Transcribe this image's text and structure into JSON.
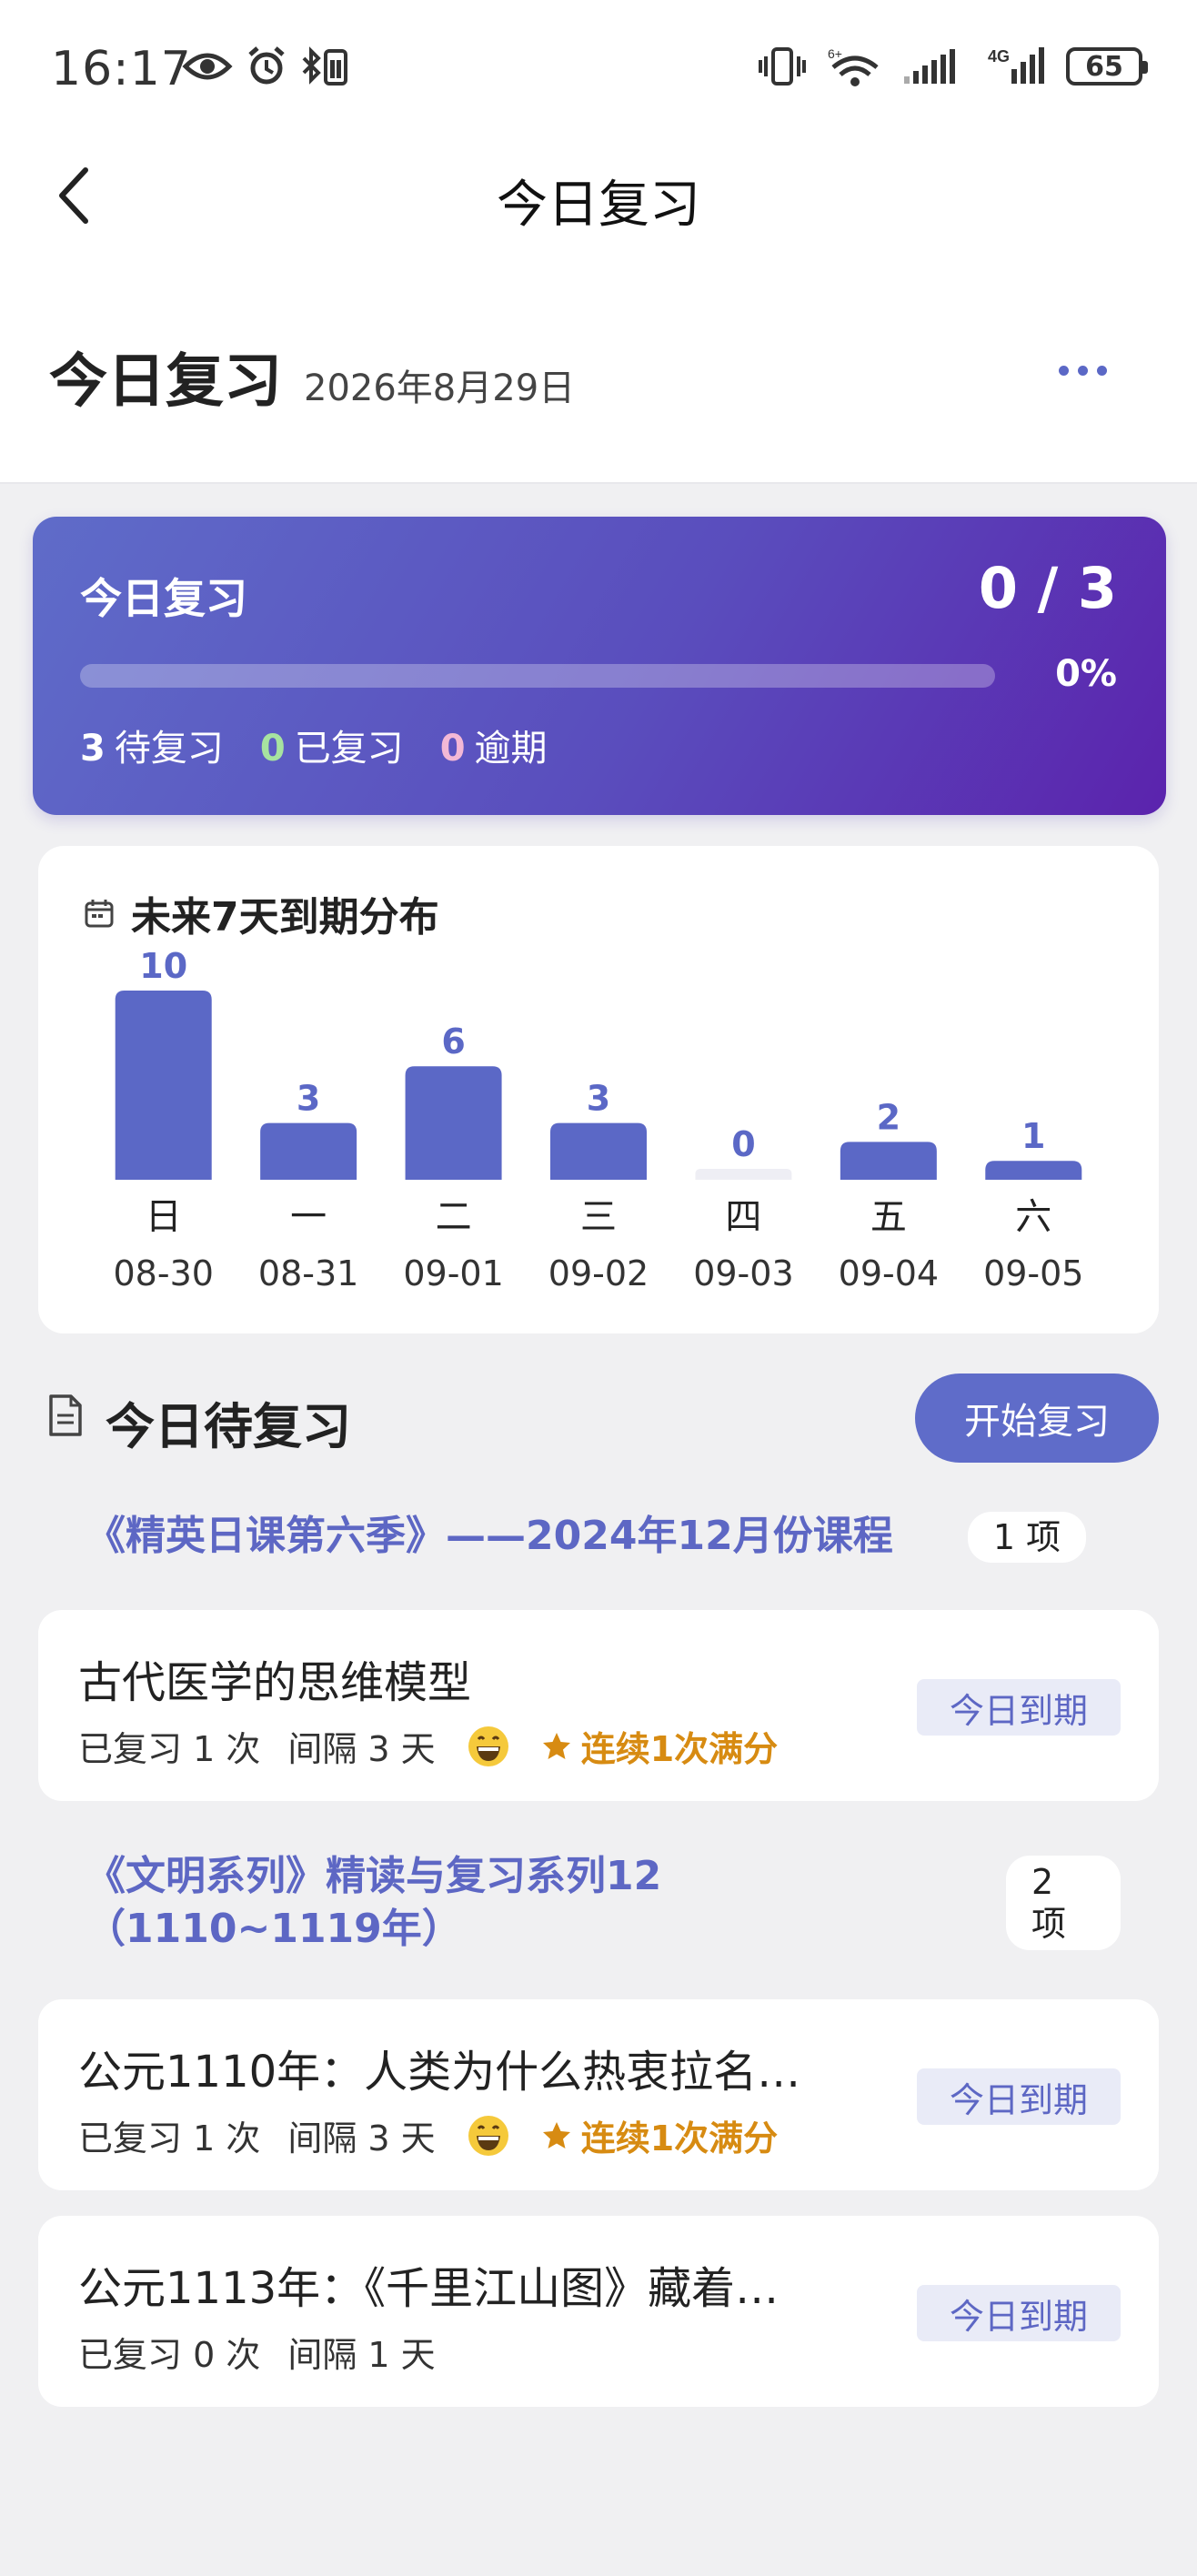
{
  "status_bar": {
    "time": "16:17",
    "battery": "65",
    "network_label": "4G",
    "wifi_label": "6+"
  },
  "nav": {
    "title": "今日复习"
  },
  "header": {
    "title": "今日复习",
    "date": "2026年8月29日"
  },
  "progress": {
    "label": "今日复习",
    "count": "0 / 3",
    "percent_text": "0%",
    "fraction": 0,
    "stats": [
      {
        "value": "3",
        "label": "待复习"
      },
      {
        "value": "0",
        "label": "已复习"
      },
      {
        "value": "0",
        "label": "逾期"
      }
    ]
  },
  "chart_card": {
    "title": "未来7天到期分布"
  },
  "chart_data": {
    "type": "bar",
    "categories": [
      "日",
      "一",
      "二",
      "三",
      "四",
      "五",
      "六"
    ],
    "dates": [
      "08-30",
      "08-31",
      "09-01",
      "09-02",
      "09-03",
      "09-04",
      "09-05"
    ],
    "values": [
      10,
      3,
      6,
      3,
      0,
      2,
      1
    ],
    "title": "未来7天到期分布",
    "ylim": [
      0,
      10
    ],
    "bar_color": "#5b68c6",
    "empty_color": "#eeeef4"
  },
  "review_section": {
    "title": "今日待复习",
    "start_button": "开始复习",
    "groups": [
      {
        "course_lines": [
          "《精英日课第六季》——2024年12月份课程"
        ],
        "count_lines": [
          "1 项"
        ],
        "items": [
          {
            "title": "古代医学的思维模型",
            "reviewed": "已复习 1 次",
            "interval": "间隔 3 天",
            "streak": "连续1次满分",
            "due": "今日到期"
          }
        ]
      },
      {
        "course_lines": [
          "《文明系列》精读与复习系列12",
          "（1110~1119年）"
        ],
        "count_lines": [
          "2",
          "项"
        ],
        "items": [
          {
            "title": "公元1110年：人类为什么热衷拉名…",
            "reviewed": "已复习 1 次",
            "interval": "间隔 3 天",
            "streak": "连续1次满分",
            "due": "今日到期"
          },
          {
            "title": "公元1113年：《千里江山图》藏着…",
            "reviewed": "已复习 0 次",
            "interval": "间隔 1 天",
            "streak": "",
            "due": "今日到期"
          }
        ]
      }
    ]
  }
}
